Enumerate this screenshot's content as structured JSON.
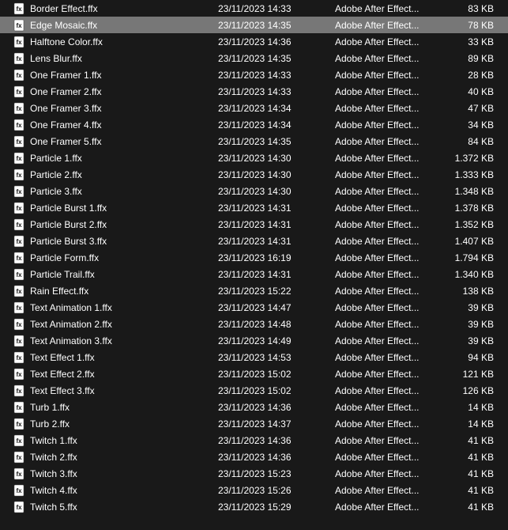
{
  "type_label": "Adobe After Effect...",
  "files": [
    {
      "name": "Border Effect.ffx",
      "date": "23/11/2023 14:33",
      "size": "83 KB",
      "selected": false
    },
    {
      "name": "Edge Mosaic.ffx",
      "date": "23/11/2023 14:35",
      "size": "78 KB",
      "selected": true
    },
    {
      "name": "Halftone Color.ffx",
      "date": "23/11/2023 14:36",
      "size": "33 KB",
      "selected": false
    },
    {
      "name": "Lens Blur.ffx",
      "date": "23/11/2023 14:35",
      "size": "89 KB",
      "selected": false
    },
    {
      "name": "One Framer 1.ffx",
      "date": "23/11/2023 14:33",
      "size": "28 KB",
      "selected": false
    },
    {
      "name": "One Framer 2.ffx",
      "date": "23/11/2023 14:33",
      "size": "40 KB",
      "selected": false
    },
    {
      "name": "One Framer 3.ffx",
      "date": "23/11/2023 14:34",
      "size": "47 KB",
      "selected": false
    },
    {
      "name": "One Framer 4.ffx",
      "date": "23/11/2023 14:34",
      "size": "34 KB",
      "selected": false
    },
    {
      "name": "One Framer 5.ffx",
      "date": "23/11/2023 14:35",
      "size": "84 KB",
      "selected": false
    },
    {
      "name": "Particle 1.ffx",
      "date": "23/11/2023 14:30",
      "size": "1.372 KB",
      "selected": false
    },
    {
      "name": "Particle 2.ffx",
      "date": "23/11/2023 14:30",
      "size": "1.333 KB",
      "selected": false
    },
    {
      "name": "Particle 3.ffx",
      "date": "23/11/2023 14:30",
      "size": "1.348 KB",
      "selected": false
    },
    {
      "name": "Particle Burst 1.ffx",
      "date": "23/11/2023 14:31",
      "size": "1.378 KB",
      "selected": false
    },
    {
      "name": "Particle Burst 2.ffx",
      "date": "23/11/2023 14:31",
      "size": "1.352 KB",
      "selected": false
    },
    {
      "name": "Particle Burst 3.ffx",
      "date": "23/11/2023 14:31",
      "size": "1.407 KB",
      "selected": false
    },
    {
      "name": "Particle Form.ffx",
      "date": "23/11/2023 16:19",
      "size": "1.794 KB",
      "selected": false
    },
    {
      "name": "Particle Trail.ffx",
      "date": "23/11/2023 14:31",
      "size": "1.340 KB",
      "selected": false
    },
    {
      "name": "Rain Effect.ffx",
      "date": "23/11/2023 15:22",
      "size": "138 KB",
      "selected": false
    },
    {
      "name": "Text Animation 1.ffx",
      "date": "23/11/2023 14:47",
      "size": "39 KB",
      "selected": false
    },
    {
      "name": "Text Animation 2.ffx",
      "date": "23/11/2023 14:48",
      "size": "39 KB",
      "selected": false
    },
    {
      "name": "Text Animation 3.ffx",
      "date": "23/11/2023 14:49",
      "size": "39 KB",
      "selected": false
    },
    {
      "name": "Text Effect 1.ffx",
      "date": "23/11/2023 14:53",
      "size": "94 KB",
      "selected": false
    },
    {
      "name": "Text Effect 2.ffx",
      "date": "23/11/2023 15:02",
      "size": "121 KB",
      "selected": false
    },
    {
      "name": "Text Effect 3.ffx",
      "date": "23/11/2023 15:02",
      "size": "126 KB",
      "selected": false
    },
    {
      "name": "Turb 1.ffx",
      "date": "23/11/2023 14:36",
      "size": "14 KB",
      "selected": false
    },
    {
      "name": "Turb 2.ffx",
      "date": "23/11/2023 14:37",
      "size": "14 KB",
      "selected": false
    },
    {
      "name": "Twitch 1.ffx",
      "date": "23/11/2023 14:36",
      "size": "41 KB",
      "selected": false
    },
    {
      "name": "Twitch 2.ffx",
      "date": "23/11/2023 14:36",
      "size": "41 KB",
      "selected": false
    },
    {
      "name": "Twitch 3.ffx",
      "date": "23/11/2023 15:23",
      "size": "41 KB",
      "selected": false
    },
    {
      "name": "Twitch 4.ffx",
      "date": "23/11/2023 15:26",
      "size": "41 KB",
      "selected": false
    },
    {
      "name": "Twitch 5.ffx",
      "date": "23/11/2023 15:29",
      "size": "41 KB",
      "selected": false
    }
  ]
}
